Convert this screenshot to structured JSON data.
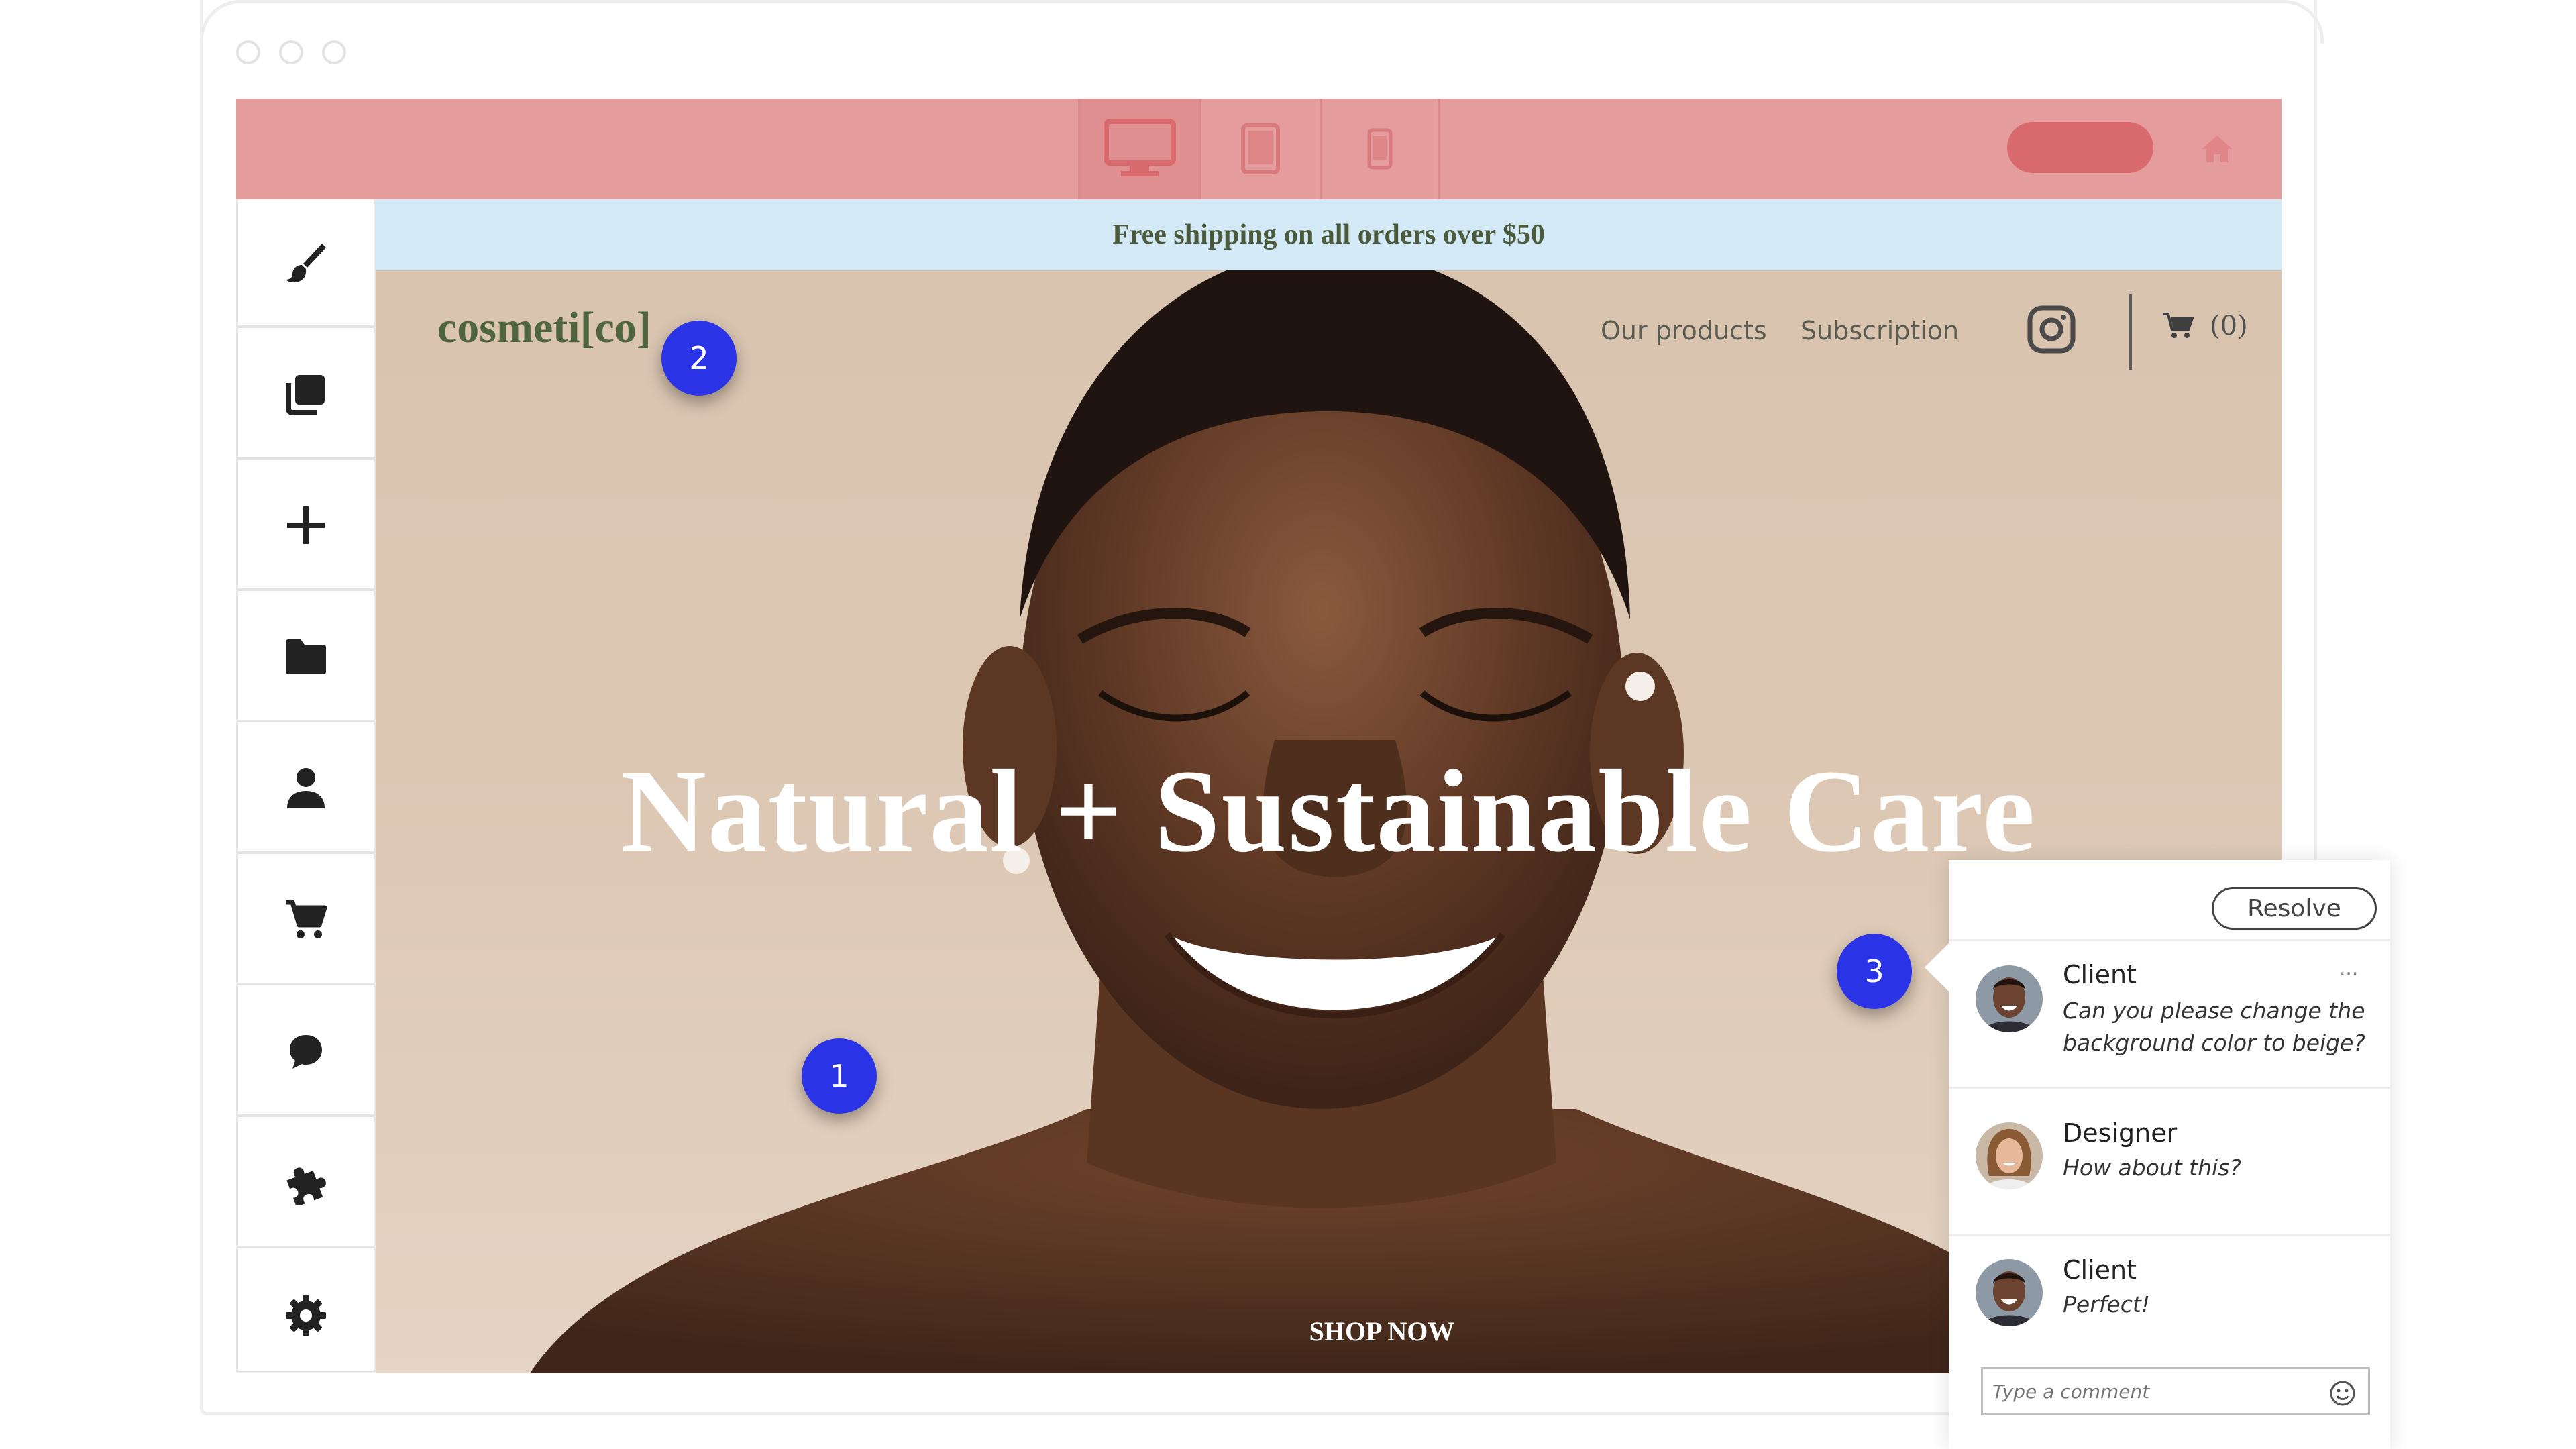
{
  "editor": {
    "device_buttons": [
      {
        "name": "desktop-icon",
        "active": true
      },
      {
        "name": "tablet-icon",
        "active": false
      },
      {
        "name": "mobile-icon",
        "active": false
      }
    ],
    "sidebar_icons": [
      "brush-icon",
      "layers-icon",
      "plus-icon",
      "folder-icon",
      "user-icon",
      "cart-icon",
      "chat-icon",
      "puzzle-icon",
      "gear-icon"
    ],
    "colors": {
      "topbar": "#e59c9d",
      "publish": "#d8696c",
      "marker": "#2a34e6",
      "promo_bg": "#d3e9f6",
      "brand_green": "#4e6540"
    }
  },
  "site": {
    "promo": "Free shipping on all orders over $50",
    "brand": "cosmeti[co]",
    "nav": {
      "products": "Our products",
      "subscription": "Subscription"
    },
    "cart_count": "0",
    "hero_title": "Natural + Sustainable Care",
    "cta": "SHOP NOW"
  },
  "markers": {
    "m1": "1",
    "m2": "2",
    "m3": "3"
  },
  "comments": {
    "resolve": "Resolve",
    "more": "...",
    "items": [
      {
        "author": "Client",
        "text": "Can you please change the background color to beige?"
      },
      {
        "author": "Designer",
        "text": "How about this?"
      },
      {
        "author": "Client",
        "text": "Perfect!"
      }
    ],
    "input_placeholder": "Type a comment"
  }
}
